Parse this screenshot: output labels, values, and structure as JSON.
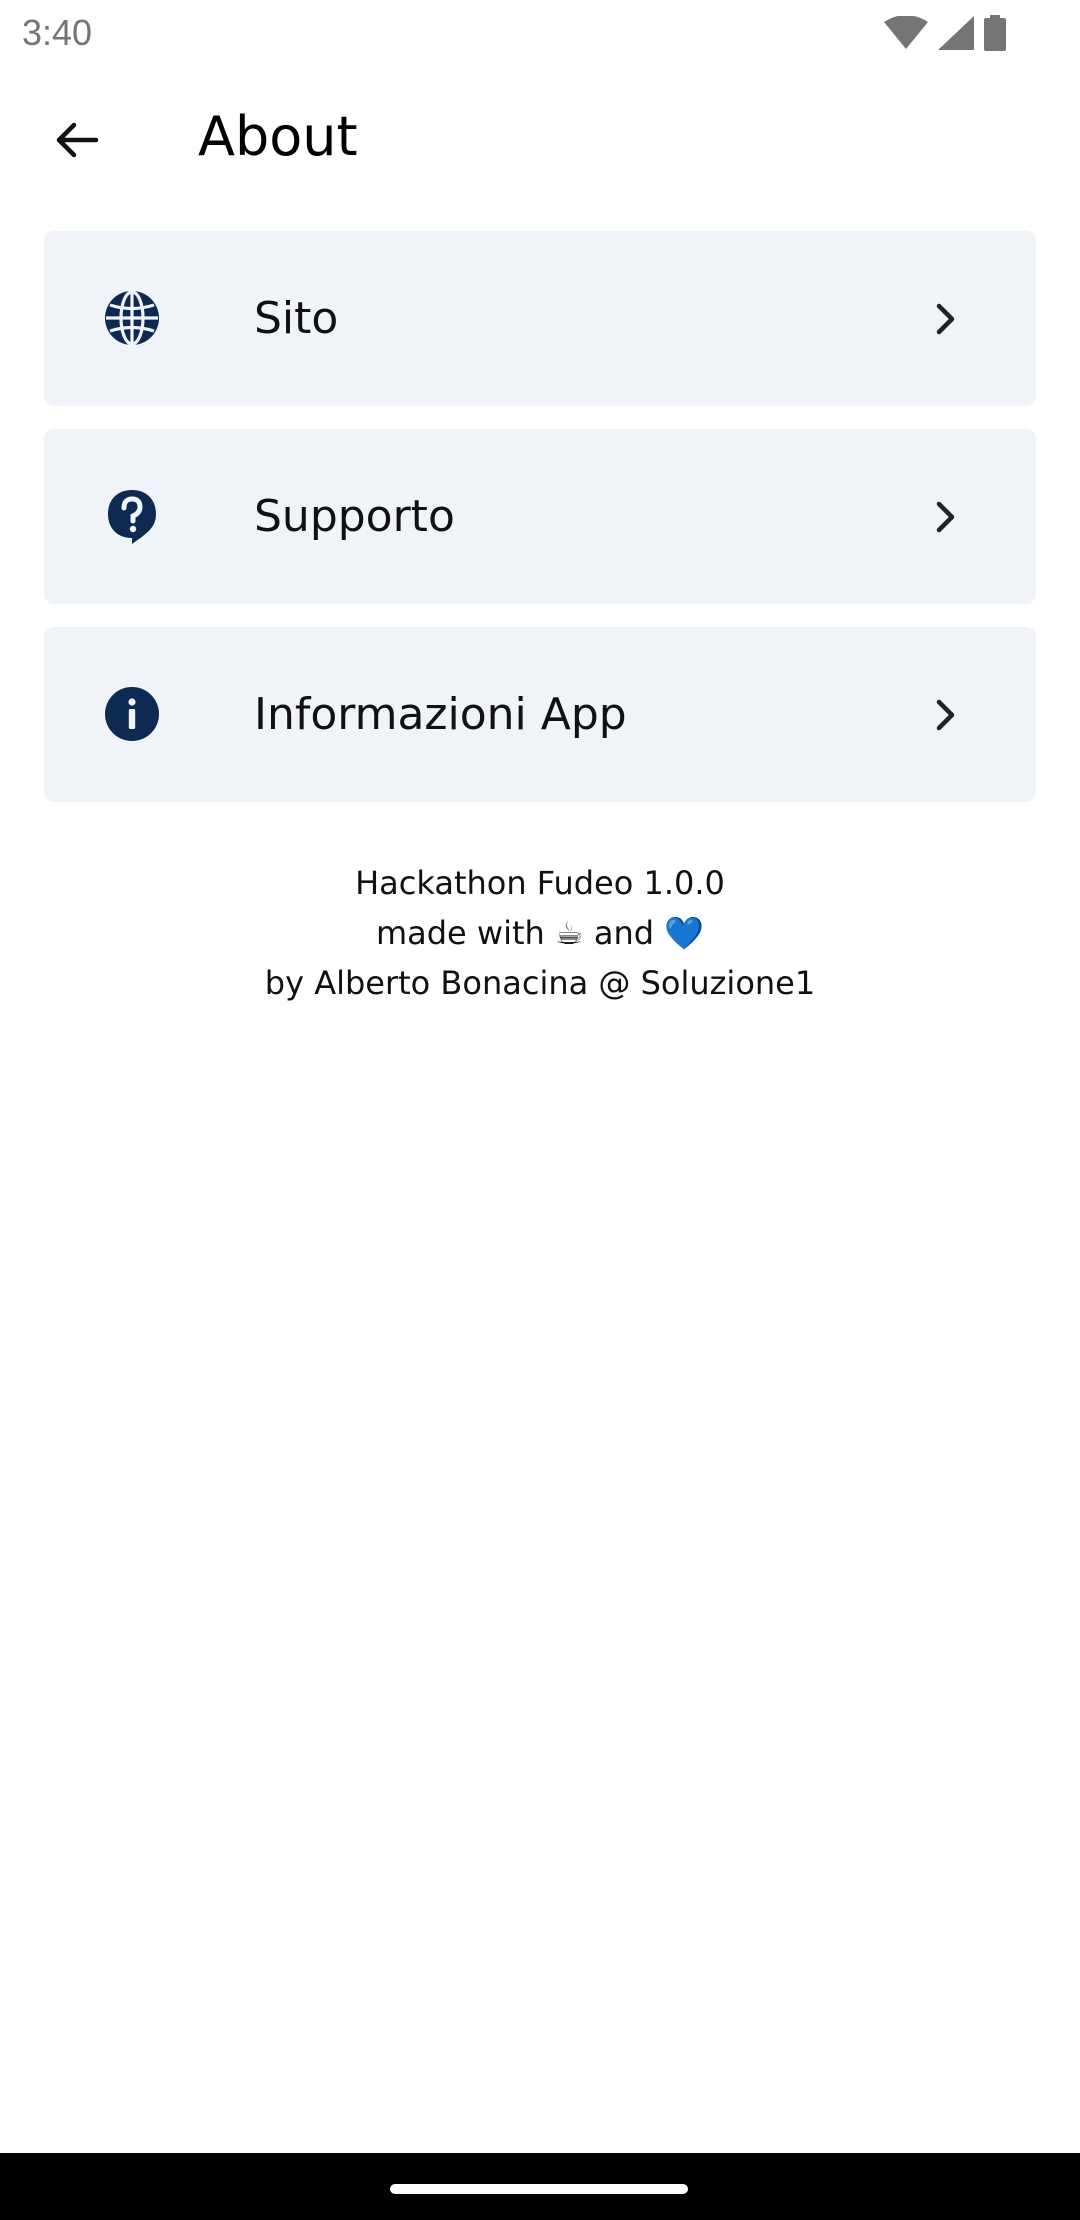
{
  "status_bar": {
    "time": "3:40",
    "icons": [
      "wifi-icon",
      "signal-icon",
      "battery-icon"
    ]
  },
  "app_bar": {
    "back_icon": "arrow-back-icon",
    "title": "About"
  },
  "menu": {
    "items": [
      {
        "label": "Sito",
        "icon": "globe-icon"
      },
      {
        "label": "Supporto",
        "icon": "help-icon"
      },
      {
        "label": "Informazioni App",
        "icon": "info-icon"
      }
    ]
  },
  "footer": {
    "line1": "Hackathon Fudeo 1.0.0",
    "line2_prefix": "made with",
    "line2_icon1": "☕",
    "line2_middle": "and",
    "line2_icon2": "💙",
    "line3": "by Alberto Bonacina @ Soluzione1"
  },
  "colors": {
    "accent": "#0f2a52",
    "card_background": "#f0f3f8",
    "text": "#111111"
  }
}
